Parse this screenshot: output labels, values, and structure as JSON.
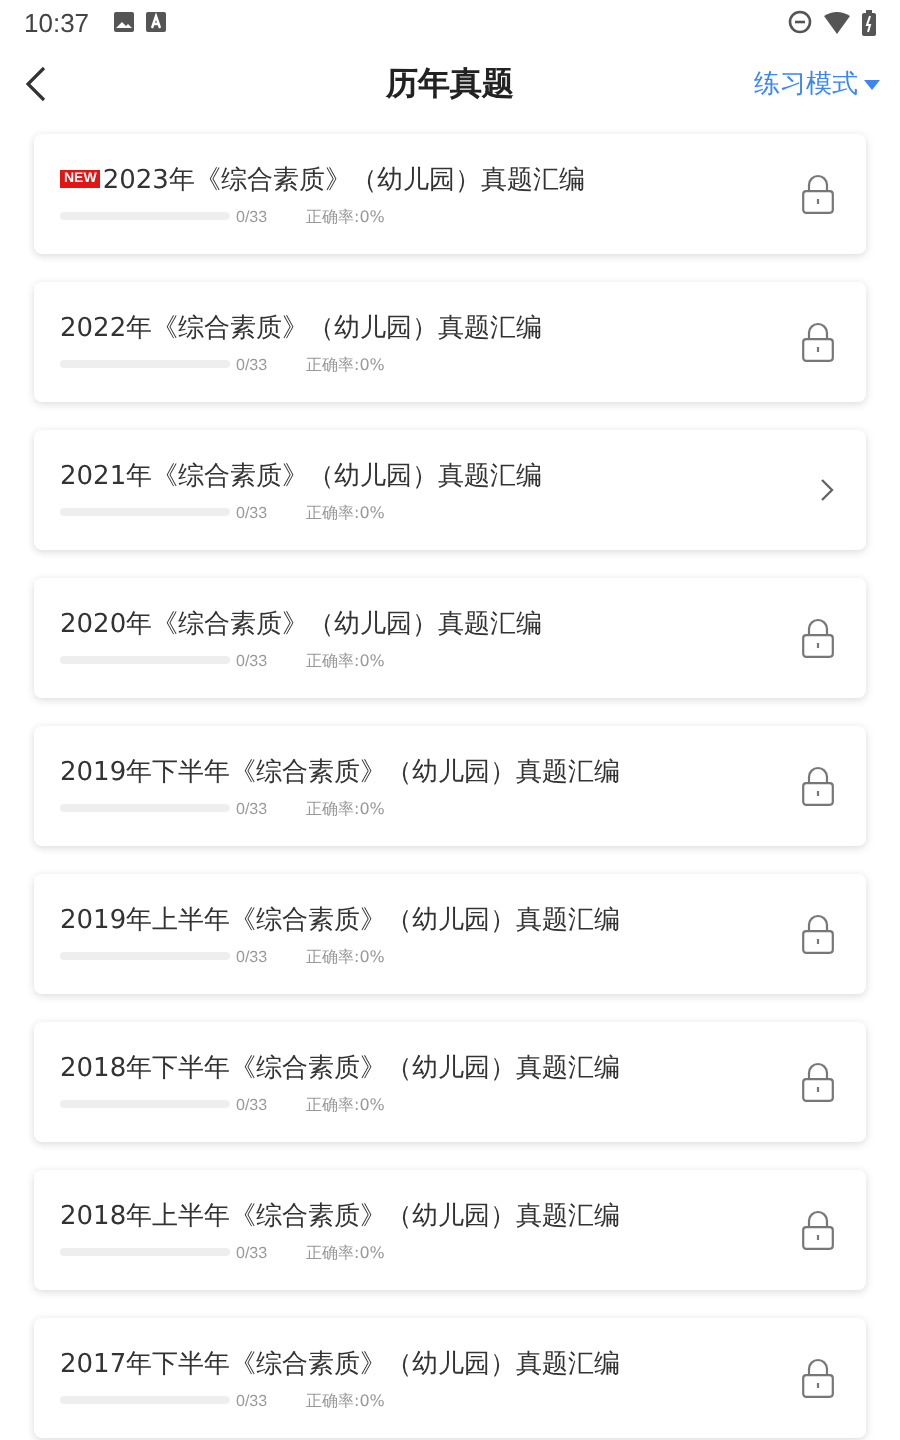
{
  "status_bar": {
    "time": "10:37"
  },
  "header": {
    "title": "历年真题",
    "mode_menu": "练习模式"
  },
  "papers": [
    {
      "badge": "NEW",
      "title": "2023年《综合素质》（幼儿园）真题汇编",
      "level": 0,
      "count": "0/33",
      "accuracy": "正确率:0%",
      "locked": true
    },
    {
      "title": "2022年《综合素质》（幼儿园）真题汇编",
      "level": 0,
      "count": "0/33",
      "accuracy": "正确率:0%",
      "locked": true
    },
    {
      "title": "2021年《综合素质》（幼儿园）真题汇编",
      "level": 0,
      "count": "0/33",
      "accuracy": "正确率:0%",
      "locked": false
    },
    {
      "title": "2020年《综合素质》（幼儿园）真题汇编",
      "level": 0,
      "count": "0/33",
      "accuracy": "正确率:0%",
      "locked": true
    },
    {
      "title": "2019年下半年《综合素质》（幼儿园）真题汇编",
      "level": 0,
      "count": "0/33",
      "accuracy": "正确率:0%",
      "locked": true
    },
    {
      "title": "2019年上半年《综合素质》（幼儿园）真题汇编",
      "level": 0,
      "count": "0/33",
      "accuracy": "正确率:0%",
      "locked": true
    },
    {
      "title": "2018年下半年《综合素质》（幼儿园）真题汇编",
      "level": 0,
      "count": "0/33",
      "accuracy": "正确率:0%",
      "locked": true
    },
    {
      "title": "2018年上半年《综合素质》（幼儿园）真题汇编",
      "level": 0,
      "count": "0/33",
      "accuracy": "正确率:0%",
      "locked": true
    },
    {
      "title": "2017年下半年《综合素质》（幼儿园）真题汇编",
      "level": 0,
      "count": "0/33",
      "accuracy": "正确率:0%",
      "locked": true
    }
  ]
}
